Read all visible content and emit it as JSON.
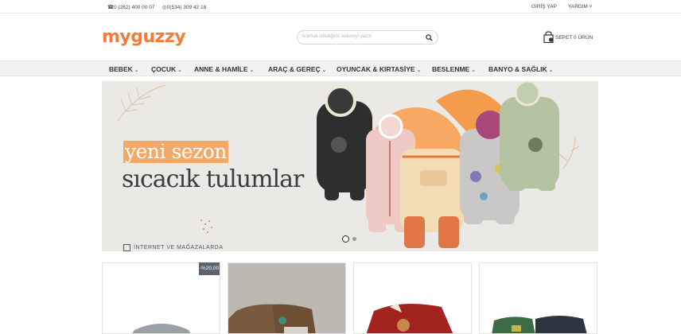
{
  "topbar": {
    "phone1": "0 (262) 400 00 07",
    "phone2": "0(534) 309 42 18",
    "login": "GİRİŞ YAP",
    "help": "YARDIM"
  },
  "header": {
    "logo": "myguzzy",
    "search_placeholder": "Aramak istediğiniz kelimeyi yazın",
    "cart_label": "SEPET",
    "cart_count": "0",
    "cart_suffix": "ÜRÜN"
  },
  "nav": {
    "items": [
      {
        "label": "BEBEK"
      },
      {
        "label": "ÇOCUK"
      },
      {
        "label": "ANNE & HAMİLE"
      },
      {
        "label": "ARAÇ & GEREÇ"
      },
      {
        "label": "OYUNCAK & KIRTASİYE"
      },
      {
        "label": "BESLENME"
      },
      {
        "label": "BANYO & SAĞLIK"
      }
    ]
  },
  "banner": {
    "headline1": "yeni sezon",
    "headline2": "sıcacık tulumlar",
    "store_text": "İNTERNET VE MAĞAZALARDA"
  },
  "products": {
    "badge": "-%20,00"
  },
  "colors": {
    "brand": "#f47c3a",
    "highlight": "#f3a868"
  }
}
